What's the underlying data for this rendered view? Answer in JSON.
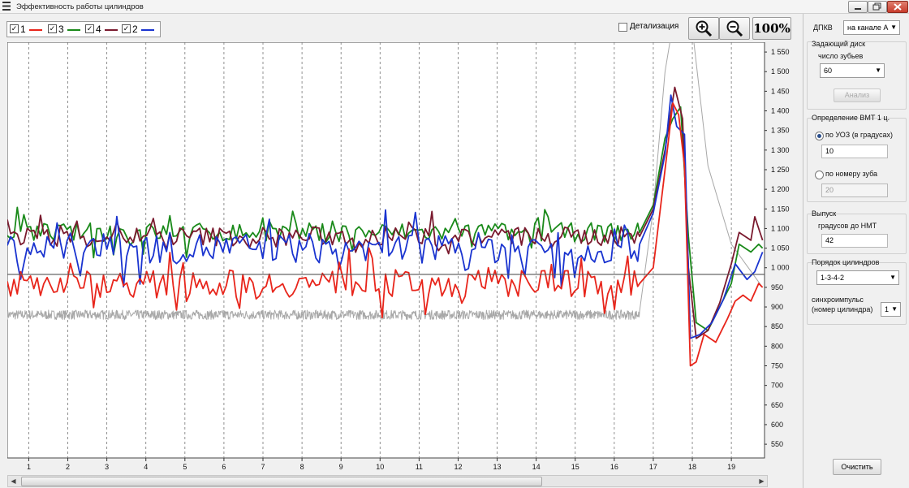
{
  "window": {
    "title": "Эффективность работы цилиндров"
  },
  "legend": [
    {
      "label": "1",
      "color": "#e8251b"
    },
    {
      "label": "3",
      "color": "#1a8a1a"
    },
    {
      "label": "4",
      "color": "#7a1a2e"
    },
    {
      "label": "2",
      "color": "#1a34d0"
    }
  ],
  "toolbar": {
    "detail_label": "Детализация",
    "zoom_in_icon": "zoom-in-icon",
    "zoom_out_icon": "zoom-out-icon",
    "reset_label": "100%"
  },
  "side": {
    "dpkv_label": "ДПКВ",
    "dpkv_value": "на канале А",
    "disk_title": "Задающий диск",
    "teeth_label": "число зубьев",
    "teeth_value": "60",
    "analyze_label": "Анализ",
    "vmt_title": "Определение ВМТ 1 ц.",
    "uoz_label": "по УОЗ (в градусах)",
    "uoz_value": "10",
    "tooth_label": "по номеру зуба",
    "tooth_value": "20",
    "exhaust_title": "Выпуск",
    "nmt_label": "градусов до НМТ",
    "nmt_value": "42",
    "order_title": "Порядок цилиндров",
    "order_value": "1-3-4-2",
    "sync_label_1": "синхроимпульс",
    "sync_label_2": "(номер цилиндра)",
    "sync_value": "1",
    "clear_label": "Очистить"
  },
  "chart_data": {
    "type": "line",
    "x_ticks": [
      1,
      2,
      3,
      4,
      5,
      6,
      7,
      8,
      9,
      10,
      11,
      12,
      13,
      14,
      15,
      16,
      17,
      18,
      19
    ],
    "y_ticks": [
      550,
      600,
      650,
      700,
      750,
      800,
      850,
      900,
      950,
      1000,
      1050,
      1100,
      1150,
      1200,
      1250,
      1300,
      1350,
      1400,
      1450,
      1500,
      1550
    ],
    "y_tick_labels": [
      "550",
      "600",
      "650",
      "700",
      "750",
      "800",
      "850",
      "900",
      "950",
      "1 000",
      "1 050",
      "1 100",
      "1 150",
      "1 200",
      "1 250",
      "1 300",
      "1 350",
      "1 400",
      "1 450",
      "1 500",
      "1 550"
    ],
    "xlim": [
      0.45,
      19.85
    ],
    "ylim": [
      515,
      1575
    ],
    "reference_line": 983,
    "grid": "vertical dashed at each x tick",
    "series": [
      {
        "label": "1",
        "color": "#e8251b",
        "baseline": 960,
        "noise": 35,
        "points": [
          [
            16.65,
            960
          ],
          [
            17.0,
            1000
          ],
          [
            17.3,
            1250
          ],
          [
            17.5,
            1420
          ],
          [
            17.65,
            1390
          ],
          [
            17.8,
            1260
          ],
          [
            17.95,
            750
          ],
          [
            18.1,
            760
          ],
          [
            18.3,
            830
          ],
          [
            18.6,
            810
          ],
          [
            18.9,
            870
          ],
          [
            19.1,
            915
          ],
          [
            19.3,
            930
          ],
          [
            19.5,
            915
          ],
          [
            19.7,
            960
          ],
          [
            19.8,
            950
          ]
        ]
      },
      {
        "label": "3",
        "color": "#1a8a1a",
        "baseline": 1090,
        "noise": 25,
        "points": [
          [
            16.65,
            1090
          ],
          [
            17.0,
            1160
          ],
          [
            17.3,
            1330
          ],
          [
            17.5,
            1380
          ],
          [
            17.7,
            1410
          ],
          [
            17.9,
            1080
          ],
          [
            18.1,
            860
          ],
          [
            18.4,
            840
          ],
          [
            18.7,
            900
          ],
          [
            19.0,
            960
          ],
          [
            19.2,
            1060
          ],
          [
            19.5,
            1040
          ],
          [
            19.7,
            1060
          ],
          [
            19.8,
            1050
          ]
        ]
      },
      {
        "label": "4",
        "color": "#7a1a2e",
        "baseline": 1080,
        "noise": 25,
        "points": [
          [
            16.65,
            1080
          ],
          [
            17.0,
            1150
          ],
          [
            17.3,
            1300
          ],
          [
            17.55,
            1460
          ],
          [
            17.75,
            1380
          ],
          [
            17.9,
            1000
          ],
          [
            18.1,
            820
          ],
          [
            18.4,
            840
          ],
          [
            18.7,
            910
          ],
          [
            19.0,
            1010
          ],
          [
            19.2,
            1090
          ],
          [
            19.5,
            1070
          ],
          [
            19.6,
            1130
          ],
          [
            19.8,
            1070
          ]
        ]
      },
      {
        "label": "2",
        "color": "#1a34d0",
        "baseline": 1050,
        "noise": 40,
        "points": [
          [
            16.65,
            1060
          ],
          [
            17.0,
            1140
          ],
          [
            17.3,
            1290
          ],
          [
            17.45,
            1440
          ],
          [
            17.6,
            1360
          ],
          [
            17.8,
            1340
          ],
          [
            17.95,
            820
          ],
          [
            18.2,
            830
          ],
          [
            18.5,
            860
          ],
          [
            18.8,
            920
          ],
          [
            19.1,
            1010
          ],
          [
            19.4,
            970
          ],
          [
            19.6,
            990
          ],
          [
            19.8,
            1040
          ]
        ]
      },
      {
        "label": "",
        "color": "#a8a8a8",
        "baseline": 880,
        "noise": 12,
        "points": [
          [
            16.65,
            890
          ],
          [
            17.0,
            1150
          ],
          [
            17.3,
            1500
          ],
          [
            17.5,
            1620
          ],
          [
            18.0,
            1610
          ],
          [
            18.4,
            1260
          ],
          [
            19.0,
            1060
          ],
          [
            19.8,
            950
          ]
        ]
      }
    ]
  }
}
